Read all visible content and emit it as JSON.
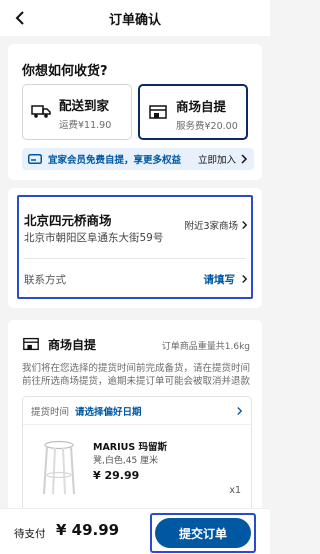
{
  "header": {
    "title": "订单确认"
  },
  "delivery_section": {
    "title": "你想如何收货?",
    "options": [
      {
        "label": "配送到家",
        "sub": "运费¥11.90",
        "selected": false
      },
      {
        "label": "商场自提",
        "sub": "服务费¥20.00",
        "selected": true
      }
    ],
    "promo": {
      "text": "宜家会员免费自提，享更多权益",
      "join": "立即加入"
    }
  },
  "store": {
    "name": "北京四元桥商场",
    "address": "北京市朝阳区阜通东大街59号",
    "nearby": "附近3家商场",
    "contact_label": "联系方式",
    "contact_action": "请填写"
  },
  "pickup": {
    "title": "商场自提",
    "weight": "订单商品重量共1.6kg",
    "notice": "我们将在您选择的提货时间前完成备货，请在提货时间前往所选商场提货，逾期未提订单可能会被取消并退款",
    "time_label": "提货时间",
    "time_select": "请选择偏好日期",
    "product": {
      "name": "MARIUS 玛留斯",
      "desc": "凳,白色,45 厘米",
      "price": "¥ 29.99",
      "qty": "x1"
    }
  },
  "footer": {
    "pay_label": "待支付",
    "amount": "¥ 49.99",
    "submit": "提交订单"
  },
  "colors": {
    "accent": "#0058a3",
    "highlight": "#2a4bd0",
    "promo_bg": "#e8f1fb"
  }
}
